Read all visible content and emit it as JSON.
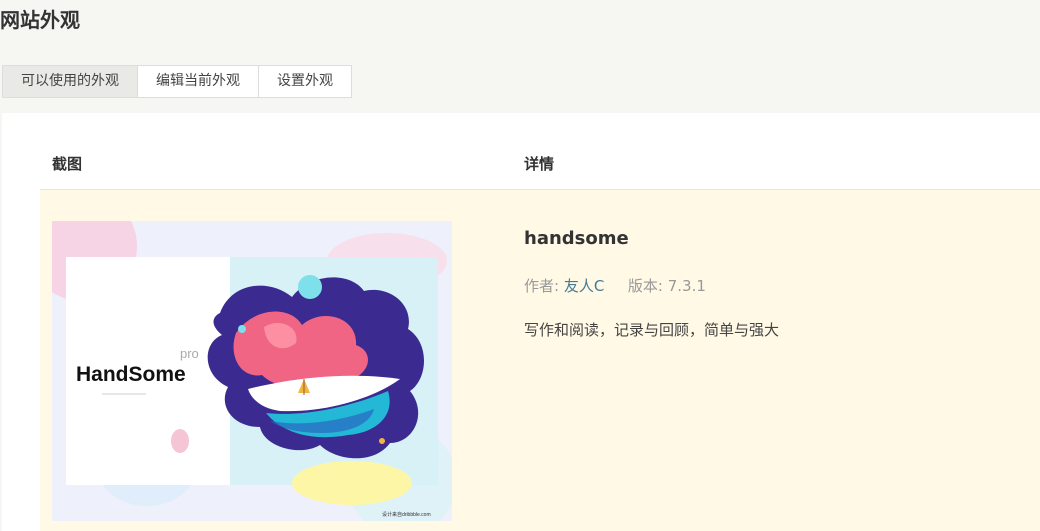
{
  "page_title": "网站外观",
  "tabs": [
    {
      "label": "可以使用的外观",
      "active": true
    },
    {
      "label": "编辑当前外观",
      "active": false
    },
    {
      "label": "设置外观",
      "active": false
    }
  ],
  "table": {
    "headers": {
      "screenshot": "截图",
      "details": "详情"
    }
  },
  "theme": {
    "name": "handsome",
    "author_label": "作者:",
    "author": "友人C",
    "version_label": "版本:",
    "version": "7.3.1",
    "description": "写作和阅读，记录与回顾，简单与强大",
    "screenshot_text": {
      "pro": "pro",
      "brand": "HandSome",
      "credit": "设计来自dribbble.com"
    }
  },
  "colors": {
    "row_highlight": "#fff9e6",
    "author_link": "#467b96"
  }
}
